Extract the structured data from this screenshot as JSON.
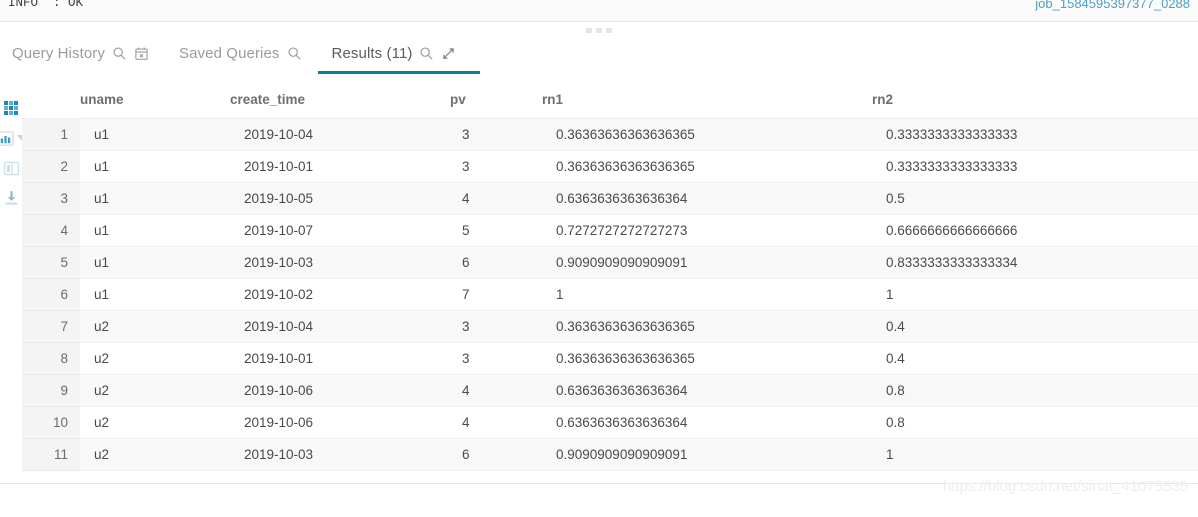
{
  "info_bar": {
    "status_text": "INFO  : OK",
    "job_id": "job_1584595397377_0288"
  },
  "tabs": [
    {
      "label": "Query History",
      "icons": [
        "search-icon",
        "calendar-icon"
      ],
      "active": false
    },
    {
      "label": "Saved Queries",
      "icons": [
        "search-icon"
      ],
      "active": false
    },
    {
      "label": "Results (11)",
      "icons": [
        "search-icon",
        "expand-icon"
      ],
      "active": true
    }
  ],
  "rail": {
    "items": [
      {
        "name": "grid-view-icon",
        "active": true
      },
      {
        "name": "bar-chart-icon",
        "active": false,
        "has_caret": true
      },
      {
        "name": "columns-icon",
        "active": false
      },
      {
        "name": "download-icon",
        "active": false
      }
    ]
  },
  "table": {
    "columns": [
      "uname",
      "create_time",
      "pv",
      "rn1",
      "rn2"
    ],
    "rows": [
      {
        "idx": "1",
        "uname": "u1",
        "create_time": "2019-10-04",
        "pv": "3",
        "rn1": "0.36363636363636365",
        "rn2": "0.3333333333333333"
      },
      {
        "idx": "2",
        "uname": "u1",
        "create_time": "2019-10-01",
        "pv": "3",
        "rn1": "0.36363636363636365",
        "rn2": "0.3333333333333333"
      },
      {
        "idx": "3",
        "uname": "u1",
        "create_time": "2019-10-05",
        "pv": "4",
        "rn1": "0.6363636363636364",
        "rn2": "0.5"
      },
      {
        "idx": "4",
        "uname": "u1",
        "create_time": "2019-10-07",
        "pv": "5",
        "rn1": "0.7272727272727273",
        "rn2": "0.6666666666666666"
      },
      {
        "idx": "5",
        "uname": "u1",
        "create_time": "2019-10-03",
        "pv": "6",
        "rn1": "0.9090909090909091",
        "rn2": "0.8333333333333334"
      },
      {
        "idx": "6",
        "uname": "u1",
        "create_time": "2019-10-02",
        "pv": "7",
        "rn1": "1",
        "rn2": "1"
      },
      {
        "idx": "7",
        "uname": "u2",
        "create_time": "2019-10-04",
        "pv": "3",
        "rn1": "0.36363636363636365",
        "rn2": "0.4"
      },
      {
        "idx": "8",
        "uname": "u2",
        "create_time": "2019-10-01",
        "pv": "3",
        "rn1": "0.36363636363636365",
        "rn2": "0.4"
      },
      {
        "idx": "9",
        "uname": "u2",
        "create_time": "2019-10-06",
        "pv": "4",
        "rn1": "0.6363636363636364",
        "rn2": "0.8"
      },
      {
        "idx": "10",
        "uname": "u2",
        "create_time": "2019-10-06",
        "pv": "4",
        "rn1": "0.6363636363636364",
        "rn2": "0.8"
      },
      {
        "idx": "11",
        "uname": "u2",
        "create_time": "2019-10-03",
        "pv": "6",
        "rn1": "0.9090909090909091",
        "rn2": "1"
      }
    ]
  },
  "watermark": "https://blog.csdn.net/sinat_41075535",
  "colors": {
    "accent": "#0b7ba0",
    "job_id": "#4f9ec4",
    "row_alt": "#f8f8f8",
    "gutter": "#f4f4f4",
    "grid_icon": "#1b86b8"
  }
}
